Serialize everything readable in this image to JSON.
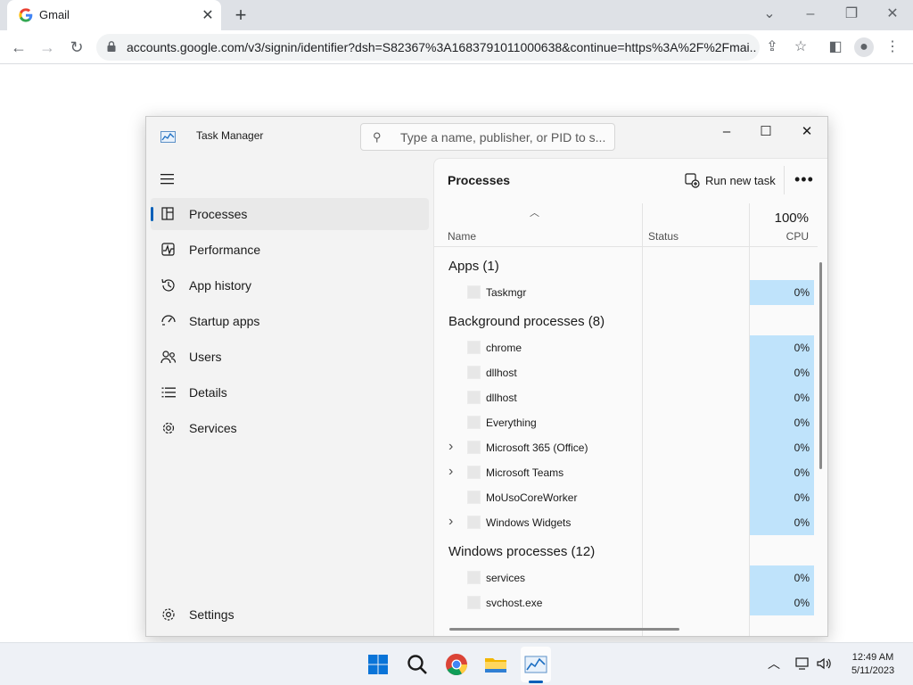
{
  "browser": {
    "tab_title": "Gmail",
    "url": "accounts.google.com/v3/signin/identifier?dsh=S82367%3A1683791011000638&continue=https%3A%2F%2Fmai..."
  },
  "task_manager": {
    "title": "Task Manager",
    "search_placeholder": "Type a name, publisher, or PID to s...",
    "nav": [
      {
        "label": "Processes",
        "icon": "processes-icon",
        "selected": true
      },
      {
        "label": "Performance",
        "icon": "performance-icon"
      },
      {
        "label": "App history",
        "icon": "app-history-icon"
      },
      {
        "label": "Startup apps",
        "icon": "startup-apps-icon"
      },
      {
        "label": "Users",
        "icon": "users-icon"
      },
      {
        "label": "Details",
        "icon": "details-icon"
      },
      {
        "label": "Services",
        "icon": "services-icon"
      }
    ],
    "settings_label": "Settings",
    "panel": {
      "title": "Processes",
      "run_new_task": "Run new task",
      "columns": {
        "name": "Name",
        "status": "Status",
        "cpu_total": "100%",
        "cpu": "CPU"
      },
      "groups": [
        {
          "label": "Apps (1)",
          "processes": [
            {
              "name": "Taskmgr",
              "cpu": "0%",
              "expandable": false
            }
          ]
        },
        {
          "label": "Background processes (8)",
          "processes": [
            {
              "name": "chrome",
              "cpu": "0%",
              "expandable": false
            },
            {
              "name": "dllhost",
              "cpu": "0%",
              "expandable": false
            },
            {
              "name": "dllhost",
              "cpu": "0%",
              "expandable": false
            },
            {
              "name": "Everything",
              "cpu": "0%",
              "expandable": false
            },
            {
              "name": "Microsoft 365 (Office)",
              "cpu": "0%",
              "expandable": true
            },
            {
              "name": "Microsoft Teams",
              "cpu": "0%",
              "expandable": true
            },
            {
              "name": "MoUsoCoreWorker",
              "cpu": "0%",
              "expandable": false
            },
            {
              "name": "Windows Widgets",
              "cpu": "0%",
              "expandable": true
            }
          ]
        },
        {
          "label": "Windows processes (12)",
          "processes": [
            {
              "name": "services",
              "cpu": "0%",
              "expandable": false
            },
            {
              "name": "svchost.exe",
              "cpu": "0%",
              "expandable": false
            }
          ]
        }
      ]
    }
  },
  "taskbar": {
    "time": "12:49 AM",
    "date": "5/11/2023"
  },
  "colors": {
    "accent": "#005fb8",
    "cpu_highlight": "#bfe3fb"
  }
}
